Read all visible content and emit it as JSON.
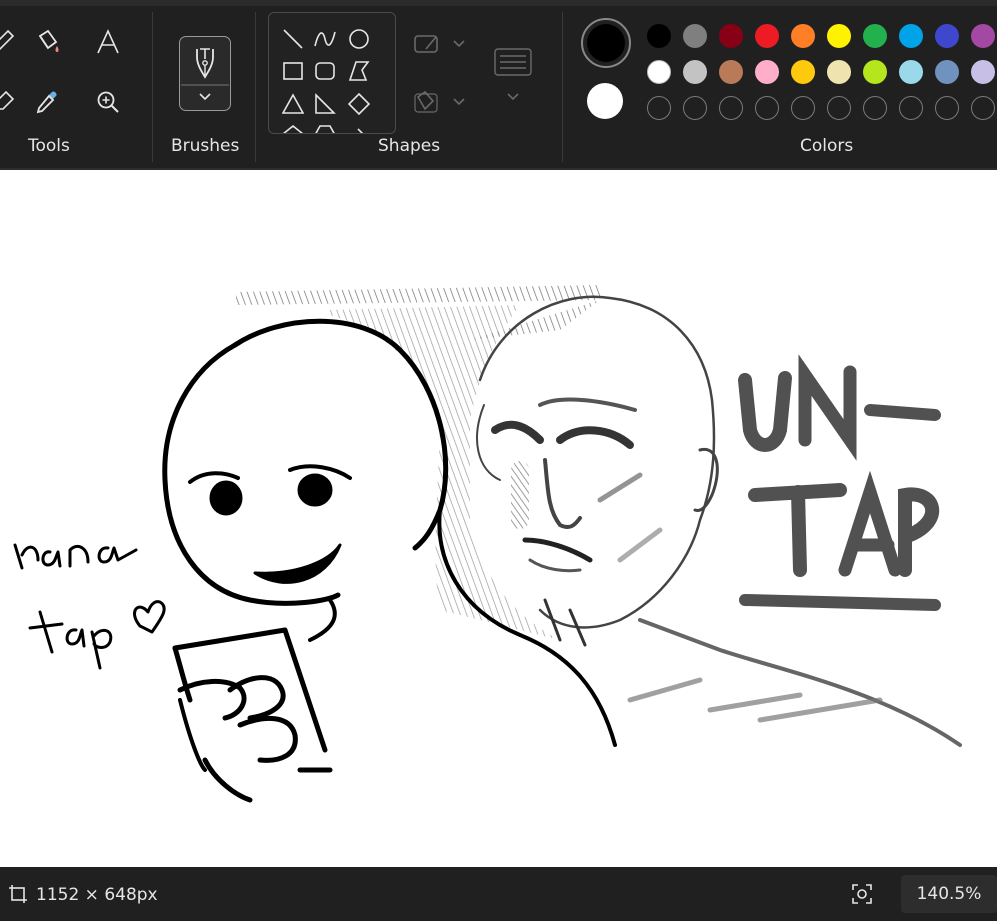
{
  "ribbon": {
    "groups": {
      "tools": "Tools",
      "brushes": "Brushes",
      "shapes": "Shapes",
      "colors": "Colors"
    },
    "tool_icons": [
      "pencil-icon",
      "fill-icon",
      "text-icon",
      "eraser-icon",
      "color-picker-icon",
      "magnifier-icon"
    ],
    "shape_icons": [
      "line",
      "curve",
      "oval",
      "rectangle",
      "rounded-rectangle",
      "polygon",
      "triangle",
      "right-triangle",
      "diamond",
      "pentagon",
      "hexagon",
      "arrow"
    ]
  },
  "colors": {
    "primary": "#000000",
    "secondary": "#ffffff",
    "row1": [
      "#000000",
      "#7f7f7f",
      "#880015",
      "#ed1c24",
      "#ff7f27",
      "#fff200",
      "#22b14c",
      "#00a2e8",
      "#3f48cc",
      "#a349a4"
    ],
    "row2": [
      "#ffffff",
      "#c3c3c3",
      "#b97a57",
      "#ffaec9",
      "#ffc90e",
      "#efe4b0",
      "#b5e61d",
      "#99d9ea",
      "#7092be",
      "#c8bfe7"
    ]
  },
  "canvas": {
    "handwriting_1": "hana",
    "handwriting_2": "tap ♡",
    "big_text_1": "UN-",
    "big_text_2": "TAP"
  },
  "status": {
    "dimensions": "1152 × 648px",
    "zoom": "140.5%"
  }
}
